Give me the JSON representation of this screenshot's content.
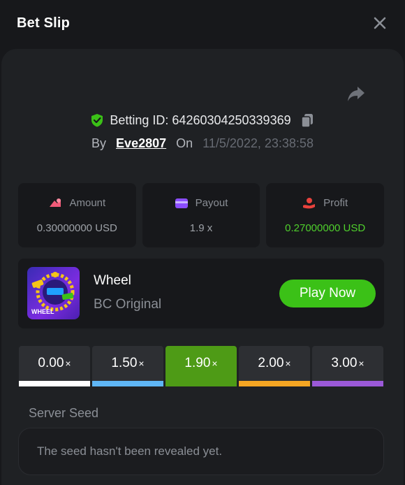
{
  "header": {
    "title": "Bet Slip"
  },
  "bet": {
    "betting_id_label": "Betting ID: 64260304250339369",
    "by_label": "By",
    "user": "Eve2807",
    "on_label": "On",
    "datetime": "11/5/2022, 23:38:58"
  },
  "stats": [
    {
      "label": "Amount",
      "value": "0.30000000 USD",
      "icon": "amount-icon",
      "color": "#f15a78"
    },
    {
      "label": "Payout",
      "value": "1.9 x",
      "icon": "wallet-icon",
      "color": "#8b4dff"
    },
    {
      "label": "Profit",
      "value": "0.27000000 USD",
      "icon": "profit-icon",
      "color": "#e8423d"
    }
  ],
  "game": {
    "name": "Wheel",
    "provider": "BC Original",
    "play_label": "Play Now",
    "thumb_text": "WHEEL"
  },
  "multipliers": [
    {
      "value": "0.00",
      "suffix": "×",
      "color": "#ffffff",
      "active": false
    },
    {
      "value": "1.50",
      "suffix": "×",
      "color": "#5fb6f5",
      "active": false
    },
    {
      "value": "1.90",
      "suffix": "×",
      "color": "#4e9b16",
      "active": true
    },
    {
      "value": "2.00",
      "suffix": "×",
      "color": "#f5a623",
      "active": false
    },
    {
      "value": "3.00",
      "suffix": "×",
      "color": "#9b59d8",
      "active": false
    }
  ],
  "seed": {
    "label": "Server Seed",
    "placeholder": "The seed hasn't been revealed yet."
  },
  "colors": {
    "accent_green": "#3bc117",
    "profit_green": "#4fcf2c"
  }
}
